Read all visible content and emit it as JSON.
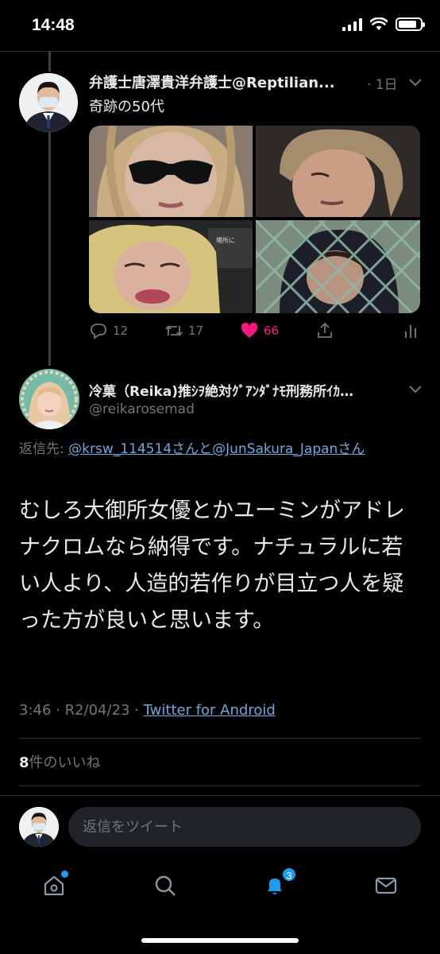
{
  "status_bar": {
    "time": "14:48",
    "battery_level": 0.85
  },
  "tweet1": {
    "name": "弁護士唐澤貴洋弁護士@Reptilian...",
    "time": "· 1日",
    "text": "奇跡の50代",
    "replies": "12",
    "retweets": "17",
    "likes": "66"
  },
  "tweet2": {
    "name": "冷菓（Reika)推ｼｦ絶対ｸﾞｱﾝﾀﾞﾅﾓ刑務所ｲｶ…",
    "handle": "@reikarosemad",
    "reply_prefix": "返信先: ",
    "reply_mention1": "@krsw_114514さんと",
    "reply_mention2": "@JunSakura_Japanさん",
    "text": "むしろ大御所女優とかユーミンがアドレナクロムなら納得です。ナチュラルに若い人より、人造的若作りが目立つ人を疑った方が良いと思います。",
    "timestamp": "3:46 · R2/04/23 · ",
    "source": "Twitter for Android",
    "likes_count": "8",
    "likes_label": "件のいいね"
  },
  "reply_bar": {
    "placeholder": "返信をツイート"
  },
  "nav": {
    "notifications_badge": "3"
  },
  "colors": {
    "accent": "#1d9bf0",
    "like": "#f91880",
    "muted": "#71767b",
    "link": "#6ea8dc"
  }
}
